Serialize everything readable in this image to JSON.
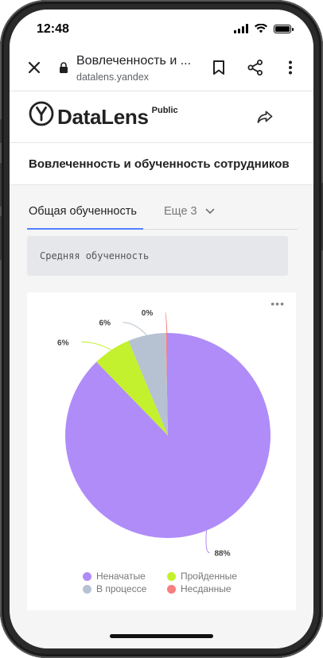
{
  "status_bar": {
    "time": "12:48"
  },
  "browser": {
    "title": "Вовлеченность и ...",
    "url": "datalens.yandex"
  },
  "header": {
    "logo_text": "DataLens",
    "logo_badge": "Public"
  },
  "dashboard": {
    "title": "Вовлеченность и обученность сотрудников",
    "tabs": [
      {
        "label": "Общая обученность",
        "active": true
      },
      {
        "label": "Еще 3",
        "active": false
      }
    ],
    "section_title": "Средняя обученность"
  },
  "colors": {
    "accent": "#5282ff",
    "not_started": "#b08cf9",
    "passed": "#c3f12e",
    "in_progress": "#b6c2d1",
    "failed": "#f77e7e"
  },
  "chart_data": {
    "type": "pie",
    "slices": [
      {
        "name": "Неначатые",
        "value": 88,
        "label": "88%",
        "color": "#b08cf9"
      },
      {
        "name": "Пройденные",
        "value": 6,
        "label": "6%",
        "color": "#c3f12e"
      },
      {
        "name": "В процессе",
        "value": 6,
        "label": "6%",
        "color": "#b6c2d1"
      },
      {
        "name": "Несданные",
        "value": 0.3,
        "label": "0%",
        "color": "#f77e7e"
      }
    ],
    "legend": [
      "Неначатые",
      "Пройденные",
      "В процессе",
      "Несданные"
    ],
    "legend_position": "bottom"
  }
}
